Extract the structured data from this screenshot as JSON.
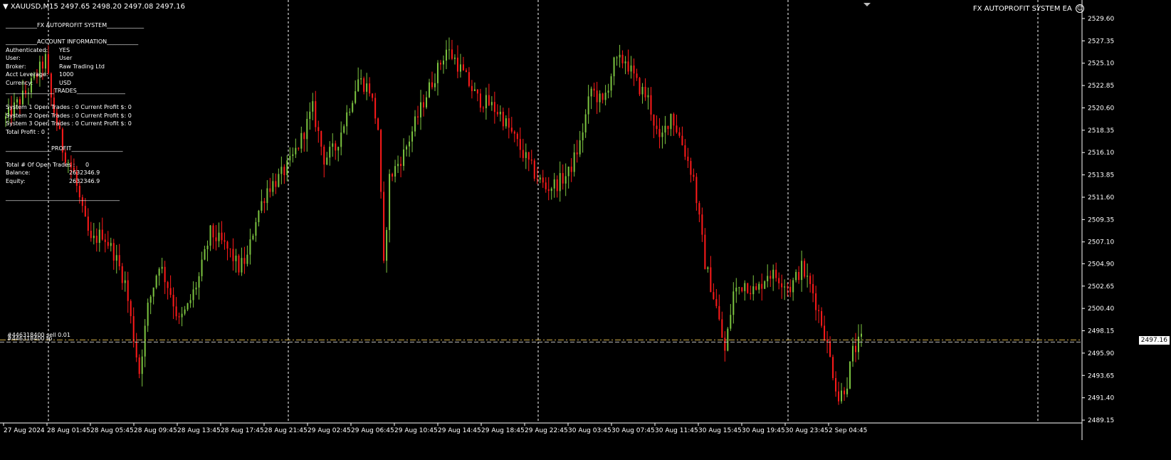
{
  "header": {
    "symbol_line": "XAUUSD,M15  2497.65 2498.20 2497.08 2497.16",
    "ea_title": "FX AUTOPROFIT SYSTEM EA",
    "smiley": "☺"
  },
  "info_panel": {
    "title_sep": "___________FX AUTOPROFIT SYSTEM_____________",
    "account_sep": "___________ACCOUNT INFORMATION___________",
    "account_rows": [
      {
        "key": "Authenticated:",
        "value": "YES"
      },
      {
        "key": "User:",
        "value": "User"
      },
      {
        "key": "Broker:",
        "value": "Raw Trading Ltd"
      },
      {
        "key": "Acct Leverage:",
        "value": "1000"
      },
      {
        "key": "Currency:",
        "value": "USD"
      }
    ],
    "trades_sep": "_________________TRADES_________________",
    "trade_rows": [
      "System 1 Open Trades :  0    Current Profit $:  0",
      "System 2 Open Trades :  0    Current Profit $:  0",
      "System 3 Open Trades :  0    Current Profit $:  0",
      "Total Profit        :  0"
    ],
    "profit_sep": "________________PROFIT__________________",
    "profit_rows": [
      {
        "key": "Total # Of Open Trades :",
        "value": "0"
      },
      {
        "key": "Balance:",
        "value": "2632346.9"
      },
      {
        "key": "Equity:",
        "value": "2632346.9"
      }
    ],
    "bottom_sep": "________________________________________"
  },
  "trade_line": {
    "ticket_label": "#446318400 sell 0.01",
    "ticket_label_2": "#446318400 tp",
    "price": 2497.16,
    "price_label": "2497.16"
  },
  "colors": {
    "bull": "#7cc440",
    "bear": "#ff1a1a",
    "grid": "#ffffff",
    "axis_text": "#ffffff",
    "trade_line": "#d6b24a",
    "bid_line": "#bdbdbd"
  },
  "chart_data": {
    "type": "candlestick",
    "title": "XAUUSD,M15",
    "y_ticks": [
      "2529.60",
      "2527.35",
      "2525.10",
      "2522.85",
      "2520.60",
      "2518.35",
      "2516.10",
      "2513.85",
      "2511.60",
      "2509.35",
      "2507.10",
      "2504.90",
      "2502.65",
      "2500.40",
      "2498.15",
      "2495.90",
      "2493.65",
      "2491.40",
      "2489.15"
    ],
    "ylim": [
      2489.15,
      2529.6
    ],
    "x_ticks": [
      "27 Aug 2024",
      "28 Aug 01:45",
      "28 Aug 05:45",
      "28 Aug 09:45",
      "28 Aug 13:45",
      "28 Aug 17:45",
      "28 Aug 21:45",
      "29 Aug 02:45",
      "29 Aug 06:45",
      "29 Aug 10:45",
      "29 Aug 14:45",
      "29 Aug 18:45",
      "29 Aug 22:45",
      "30 Aug 03:45",
      "30 Aug 07:45",
      "30 Aug 11:45",
      "30 Aug 15:45",
      "30 Aug 19:45",
      "30 Aug 23:45",
      "2 Sep 04:45"
    ],
    "session_separators": [
      "28 Aug",
      "29 Aug",
      "30 Aug",
      "2 Sep"
    ],
    "close_path": [
      [
        0,
        2519.5
      ],
      [
        8,
        2522.5
      ],
      [
        14,
        2525.5
      ],
      [
        16,
        2521.5
      ],
      [
        20,
        2516.5
      ],
      [
        24,
        2514
      ],
      [
        27,
        2510
      ],
      [
        30,
        2507
      ],
      [
        34,
        2508
      ],
      [
        38,
        2506
      ],
      [
        42,
        2503
      ],
      [
        45,
        2497.5
      ],
      [
        47,
        2494
      ],
      [
        50,
        2500.5
      ],
      [
        54,
        2505
      ],
      [
        58,
        2502
      ],
      [
        61,
        2499
      ],
      [
        64,
        2500.5
      ],
      [
        68,
        2503.5
      ],
      [
        72,
        2508
      ],
      [
        76,
        2507
      ],
      [
        79,
        2506
      ],
      [
        82,
        2504.5
      ],
      [
        85,
        2505.5
      ],
      [
        88,
        2509.5
      ],
      [
        92,
        2512.5
      ],
      [
        96,
        2513.5
      ],
      [
        100,
        2515
      ],
      [
        104,
        2517.5
      ],
      [
        108,
        2520.5
      ],
      [
        112,
        2515.5
      ],
      [
        116,
        2516.5
      ],
      [
        120,
        2520
      ],
      [
        124,
        2523.5
      ],
      [
        128,
        2522.5
      ],
      [
        131,
        2518.5
      ],
      [
        133,
        2504.5
      ],
      [
        135,
        2513.5
      ],
      [
        140,
        2516
      ],
      [
        144,
        2519
      ],
      [
        148,
        2522
      ],
      [
        152,
        2524.5
      ],
      [
        155,
        2526.5
      ],
      [
        158,
        2525.5
      ],
      [
        162,
        2523.5
      ],
      [
        166,
        2521.5
      ],
      [
        170,
        2521
      ],
      [
        174,
        2520
      ],
      [
        178,
        2518
      ],
      [
        182,
        2516
      ],
      [
        186,
        2514
      ],
      [
        190,
        2512.5
      ],
      [
        194,
        2513
      ],
      [
        198,
        2514
      ],
      [
        202,
        2517
      ],
      [
        206,
        2522.5
      ],
      [
        210,
        2521
      ],
      [
        214,
        2525
      ],
      [
        218,
        2525.5
      ],
      [
        222,
        2523
      ],
      [
        226,
        2521.5
      ],
      [
        230,
        2517
      ],
      [
        234,
        2520
      ],
      [
        238,
        2517
      ],
      [
        242,
        2513.5
      ],
      [
        246,
        2505
      ],
      [
        250,
        2500.5
      ],
      [
        253,
        2496
      ],
      [
        256,
        2502
      ],
      [
        260,
        2503
      ],
      [
        264,
        2502
      ],
      [
        268,
        2504
      ],
      [
        272,
        2503.5
      ],
      [
        276,
        2502.5
      ],
      [
        280,
        2504.5
      ],
      [
        284,
        2502
      ],
      [
        288,
        2498
      ],
      [
        291,
        2494
      ],
      [
        293,
        2491.3
      ],
      [
        296,
        2493
      ],
      [
        298,
        2496
      ],
      [
        301,
        2497.2
      ]
    ],
    "x_index_range": [
      0,
      301
    ]
  }
}
